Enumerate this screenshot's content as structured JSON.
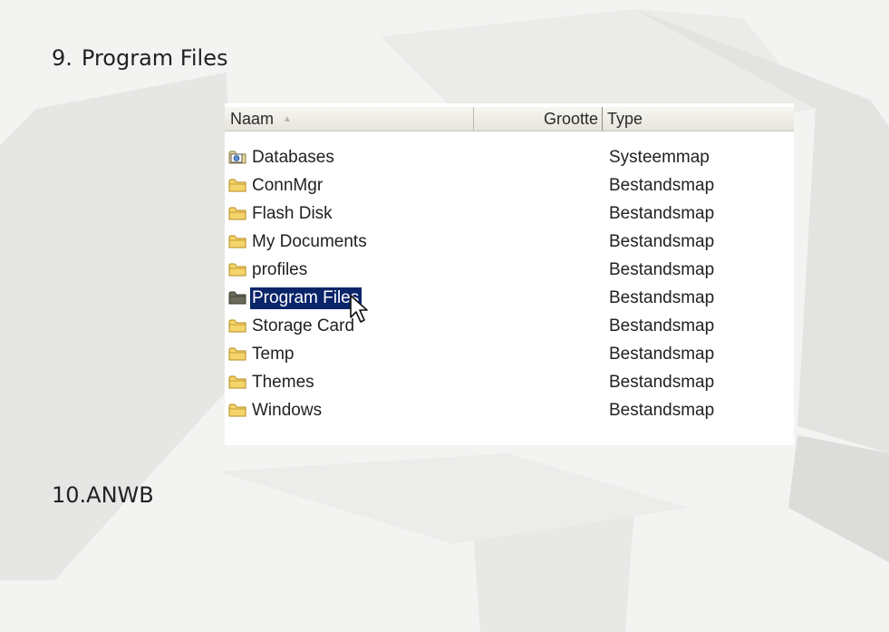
{
  "steps": [
    {
      "number": "9.",
      "title": "Program Files"
    },
    {
      "number": "10.",
      "title": "ANWB"
    }
  ],
  "explorer": {
    "columns": {
      "name": "Naam",
      "size": "Grootte",
      "type": "Type"
    },
    "sort_icon": "sort-ascending-icon",
    "rows": [
      {
        "name": "Databases",
        "type": "Systeemmap",
        "icon": "system-folder-icon",
        "selected": false
      },
      {
        "name": "ConnMgr",
        "type": "Bestandsmap",
        "icon": "folder-icon",
        "selected": false
      },
      {
        "name": "Flash Disk",
        "type": "Bestandsmap",
        "icon": "folder-icon",
        "selected": false
      },
      {
        "name": "My Documents",
        "type": "Bestandsmap",
        "icon": "folder-icon",
        "selected": false
      },
      {
        "name": "profiles",
        "type": "Bestandsmap",
        "icon": "folder-icon",
        "selected": false
      },
      {
        "name": "Program Files",
        "type": "Bestandsmap",
        "icon": "folder-icon",
        "selected": true
      },
      {
        "name": "Storage Card",
        "type": "Bestandsmap",
        "icon": "folder-icon",
        "selected": false
      },
      {
        "name": "Temp",
        "type": "Bestandsmap",
        "icon": "folder-icon",
        "selected": false
      },
      {
        "name": "Themes",
        "type": "Bestandsmap",
        "icon": "folder-icon",
        "selected": false
      },
      {
        "name": "Windows",
        "type": "Bestandsmap",
        "icon": "folder-icon",
        "selected": false
      }
    ],
    "cursor_icon": "mouse-pointer-icon"
  },
  "colors": {
    "selection": "#0a246a",
    "folder": "#f5d56b",
    "folder_selected": "#6b6b5a"
  }
}
